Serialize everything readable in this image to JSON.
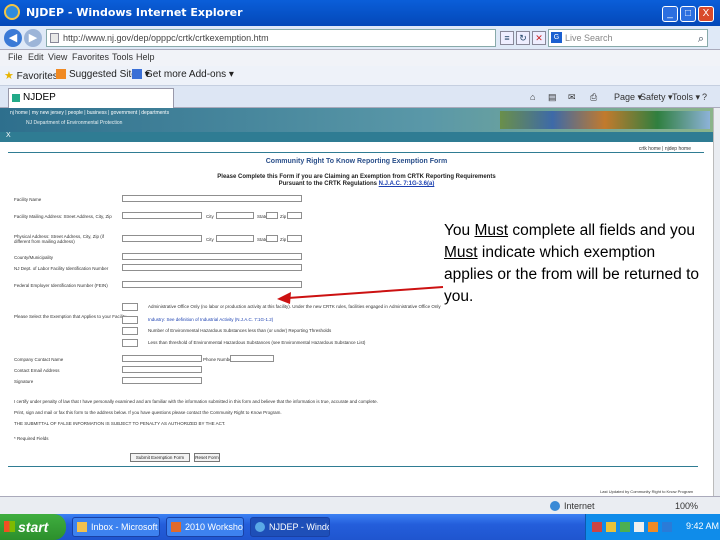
{
  "window": {
    "title": "NJDEP - Windows Internet Explorer",
    "minimize": "_",
    "maximize": "□",
    "close": "X"
  },
  "addressbar": {
    "back": "◀",
    "forward": "▶",
    "url": "http://www.nj.gov/dep/opppc/crtk/crtkexemption.htm",
    "search_placeholder": "Live Search",
    "search_logo": "G"
  },
  "menu": [
    "File",
    "Edit",
    "View",
    "Favorites",
    "Tools",
    "Help"
  ],
  "favorites": {
    "favorites_label": "Favorites",
    "suggested": "Suggested Sites ▾",
    "addons": "Get more Add-ons ▾"
  },
  "tabs": {
    "active_label": "NJDEP"
  },
  "commandbar": {
    "page": "Page ▾",
    "safety": "Safety ▾",
    "tools": "Tools ▾",
    "help": "?"
  },
  "site": {
    "breadcrumbs": "nj home | my new jersey | people | business | government | departments",
    "agency": "NJ Department of Environmental Protection",
    "close_x": "X",
    "toplinks": "crtk home | njdep home"
  },
  "form": {
    "title": "Community Right To Know Reporting Exemption Form",
    "instruction1": "Please Complete this Form if you are Claiming an Exemption from CRTK Reporting Requirements",
    "instruction2_prefix": "Pursuant to the CRTK Regulations ",
    "instruction2_link": "N.J.A.C. 7:1G-3.6(a)",
    "fields": [
      "Facility Name",
      "Facility Mailing Address: Street Address, City, Zip",
      "Physical Address: Street Address, City, Zip (if different from mailing address)",
      "County/Municipality",
      "NJ Dept. of Labor Facility Identification Number",
      "Federal Employer Identification Number (FEIN)",
      "Please Select the Exemption that Applies to your Facility"
    ],
    "city_label": "City",
    "state_label": "State",
    "zip_label": "Zip",
    "exemptions": [
      "Administrative Office Only (no labor or production activity at this facility). Under the new CRTK rules, facilities engaged in Administrative Office Only",
      "Industry: See definition of Industrial Activity (N.J.A.C. 7:1G-1.2)",
      "Number of Environmental Hazardous Substances less than (or under) Reporting Thresholds",
      "Less than threshold of Environmental Hazardous Substances (see Environmental Hazardous Substance List)"
    ],
    "contact_fields": [
      "Company Contact Name",
      "Contact Email Address",
      "Signature"
    ],
    "phone_label": "Phone Number",
    "certification": "I certify under penalty of law that I have personally examined and am familiar with the information submitted in this form and believe that the information is true, accurate and complete.",
    "mail_note": "Print, sign and mail or fax this form to the address below. If you have questions please contact the Community Right to Know Program.",
    "false_note": "THE SUBMITTAL OF FALSE INFORMATION IS SUBJECT TO PENALTY AS AUTHORIZED BY THE ACT.",
    "required_note": "* Required Fields",
    "submit_label": "Submit Exemption Form",
    "reset_label": "Reset Form",
    "footnote": "Last Updated by Community Right to Know Program"
  },
  "annotation": {
    "part1": "You ",
    "must1": "Must",
    "part2": " complete all fields and you ",
    "must2": "Must",
    "part3": " indicate which exemption applies or the from will be returned to you."
  },
  "statusbar": {
    "zone": "Internet",
    "zoom": "100%"
  },
  "taskbar": {
    "start": "start",
    "tasks": [
      "Inbox - Microsoft Outl...",
      "2010 Workshop Webi...",
      "NJDEP - Windows Inte..."
    ],
    "time": "9:42 AM"
  },
  "colors": {
    "banner": "#2f7c93",
    "form_title": "#2a4f8a",
    "arrow": "#cc1111",
    "taskbar": "#245edb",
    "start_button": "#2c8f2c"
  }
}
